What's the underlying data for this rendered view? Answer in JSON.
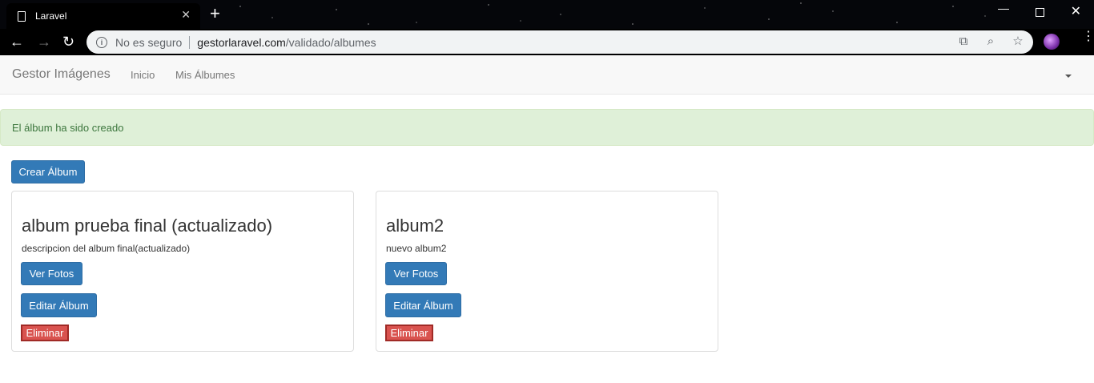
{
  "browser": {
    "tab_title": "Laravel",
    "tab_close": "✕",
    "new_tab": "+",
    "security_label": "No es seguro",
    "url_host": "gestorlaravel.com",
    "url_path": "/validado/albumes"
  },
  "navbar": {
    "brand": "Gestor Imágenes",
    "links": [
      "Inicio",
      "Mis Álbumes"
    ]
  },
  "alert": {
    "message": "El álbum ha sido creado"
  },
  "actions": {
    "create_label": "Crear Álbum"
  },
  "albums": [
    {
      "title": "album prueba final (actualizado)",
      "description": "descripcion del album final(actualizado)",
      "view_label": "Ver Fotos",
      "edit_label": "Editar Álbum",
      "delete_label": "Eliminar"
    },
    {
      "title": "album2",
      "description": "nuevo album2",
      "view_label": "Ver Fotos",
      "edit_label": "Editar Álbum",
      "delete_label": "Eliminar"
    }
  ],
  "colors": {
    "primary": "#337ab7",
    "danger": "#d9534f",
    "success_bg": "#dff0d8",
    "success_text": "#3c763d"
  }
}
